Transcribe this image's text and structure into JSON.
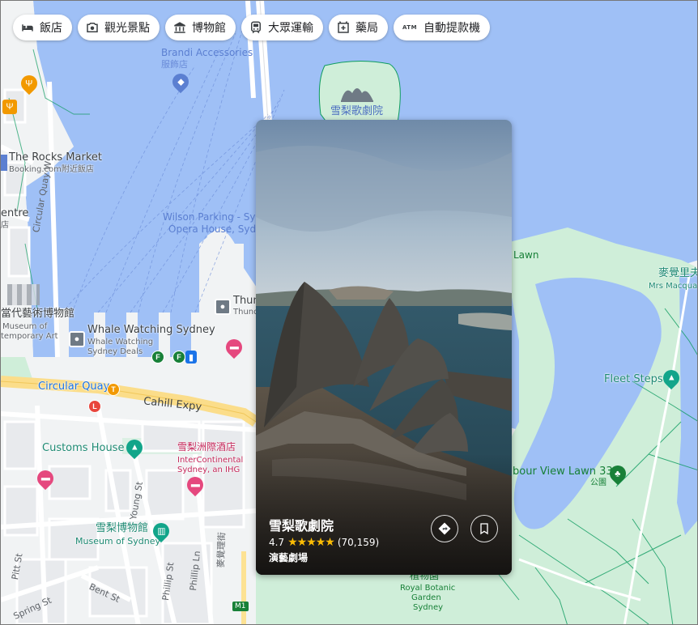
{
  "chips": [
    {
      "label": "飯店",
      "icon": "hotel-icon"
    },
    {
      "label": "觀光景點",
      "icon": "camera-icon"
    },
    {
      "label": "博物館",
      "icon": "museum-icon"
    },
    {
      "label": "大眾運輸",
      "icon": "transit-icon"
    },
    {
      "label": "藥局",
      "icon": "pharmacy-icon"
    },
    {
      "label": "自動提款機",
      "icon": "atm-icon"
    }
  ],
  "atm_badge": "ATM",
  "map_labels": {
    "brandi": "Brandi Accessories",
    "brandi_sub": "服飾店",
    "opera_house": "雪梨歌劇院",
    "rocks_market": "The Rocks Market",
    "rocks_market_sub": "Booking.com附近飯店",
    "centre": "entre",
    "centre_sub": "店",
    "wilson_1": "Wilson Parking - Sy",
    "wilson_2": "Opera House, Syd",
    "thun": "Thun",
    "thun_sub": "Thund",
    "mca": "當代藝術博物館",
    "mca_sub1": "Museum of",
    "mca_sub2": "temporary Art",
    "whale": "Whale Watching Sydney",
    "whale_sub1": "Whale Watching",
    "whale_sub2": "Sydney Deals",
    "circular_quay": "Circular Quay",
    "cahill": "Cahill Expy",
    "circular_quay_w": "Circular Quay W",
    "customs": "Customs House",
    "intercontinental": "雪梨洲際酒店",
    "intercontinental_sub1": "InterContinental",
    "intercontinental_sub2": "Sydney, an IHG",
    "museum_sydney": "雪梨博物館",
    "museum_sydney_sub": "Museum of Sydney",
    "young_st": "Young St",
    "phillip_st": "Phillip St",
    "phillip_ln": "Phillip Ln",
    "macquarie_st": "麥覺理街",
    "pitt_st": "Pitt St",
    "spring_st": "Spring St",
    "bent_st": "Bent St",
    "lawn": "Lawn",
    "macquarie_chair": "麥覺里夫",
    "macquarie_chair_sub": "Mrs Macqua",
    "fleet_steps": "Fleet Steps",
    "harbour_lawn": "bour View Lawn 33",
    "harbour_lawn_sub": "公園",
    "botanic_cn": "植物園",
    "botanic_1": "Royal Botanic",
    "botanic_2": "Garden",
    "botanic_3": "Sydney",
    "m1": "M1",
    "ferry_f": "F",
    "train_t": "T",
    "light_l": "L"
  },
  "card": {
    "title": "雪梨歌劇院",
    "rating": "4.7",
    "stars": "★★★★★",
    "review_count": "(70,159)",
    "category": "演藝劇場",
    "rating_value": 4.7
  },
  "colors": {
    "water": "#9fc0f6",
    "land": "#f1f3f4",
    "park": "#cfeed9",
    "road_major": "#fde293",
    "road_minor": "#ffffff",
    "card_star": "#fbbc04"
  }
}
